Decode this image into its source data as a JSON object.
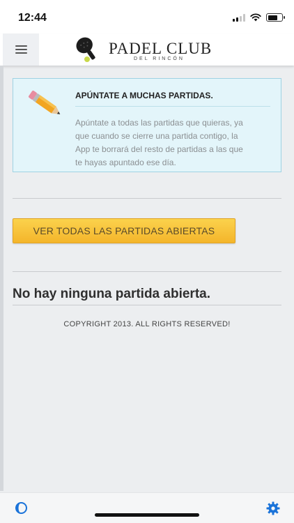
{
  "status_bar": {
    "time": "12:44",
    "battery_level": 0.7
  },
  "header": {
    "logo_title": "PADEL CLUB",
    "logo_subtitle": "DEL RINCÓN"
  },
  "info_box": {
    "title": "APÚNTATE A MUCHAS PARTIDAS.",
    "line1": "Apúntate a todas las partidas que quieras, ya",
    "line2": "que cuando se cierre una partida contigo, la",
    "line3": "App te borrará del resto de partidas a las que",
    "line4": "te hayas apuntado ese día."
  },
  "buttons": {
    "open_games": "VER TODAS LAS PARTIDAS ABIERTAS"
  },
  "main": {
    "empty_message": "No hay ninguna partida abierta.",
    "copyright": "COPYRIGHT 2013. ALL RIGHTS RESERVED!"
  },
  "colors": {
    "accent_button": "#f4b52b",
    "info_bg": "#e3f5fa",
    "settings_icon": "#1a73d9"
  },
  "icons": {
    "menu": "hamburger-icon",
    "logo": "padel-racket-icon",
    "info": "pencil-icon",
    "bottom_left": "app-switch-icon",
    "bottom_right": "gear-icon"
  }
}
